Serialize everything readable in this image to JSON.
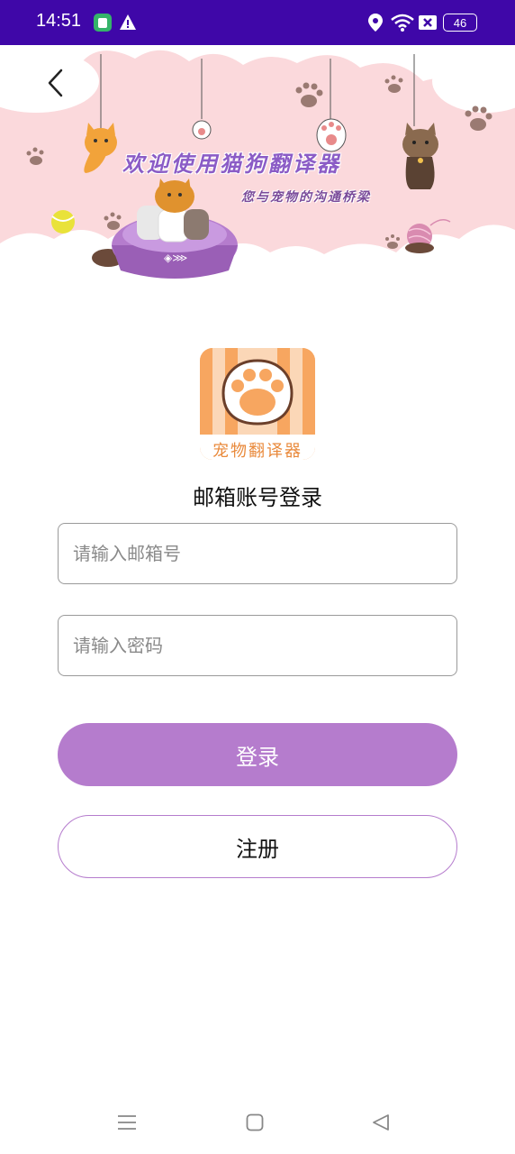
{
  "status_bar": {
    "time": "14:51",
    "battery": "46",
    "icons": [
      "app-notification-icon",
      "warning-icon",
      "location-icon",
      "wifi-icon",
      "sim-icon",
      "battery-icon"
    ]
  },
  "banner": {
    "title": "欢迎使用猫狗翻译器",
    "subtitle": "您与宠物的沟通桥梁"
  },
  "logo": {
    "text": "宠物翻译器"
  },
  "login": {
    "heading": "邮箱账号登录",
    "email_placeholder": "请输入邮箱号",
    "email_value": "",
    "password_placeholder": "请输入密码",
    "password_value": "",
    "login_label": "登录",
    "register_label": "注册"
  },
  "colors": {
    "status_bar": "#3f07a8",
    "accent": "#b57ccd",
    "banner_bg": "#fbd9dc",
    "logo_orange": "#f7a660"
  }
}
